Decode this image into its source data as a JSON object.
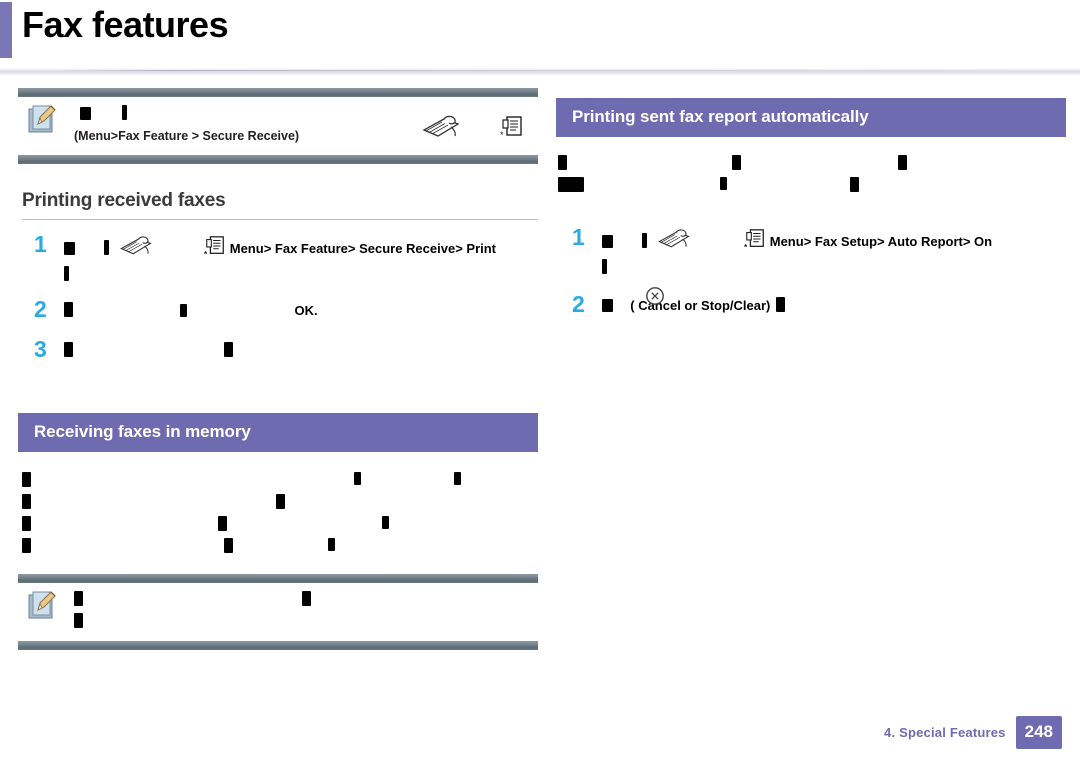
{
  "page": {
    "title": "Fax features",
    "accent_color": "#7b77b5",
    "step_number_color": "#29abe2",
    "note_bar_color": "#6c7a83"
  },
  "footer": {
    "chapter": "4.  Special Features",
    "page_number": "248"
  },
  "note_top": {
    "icon": "note-pencil-icon",
    "glyph_line": "",
    "path_text": "(Menu>Fax Feature    >  Secure Receive)",
    "inline_icons": [
      "fax-machine-icon",
      "menu-button-icon"
    ]
  },
  "sections": [
    {
      "id": "printing-received-faxes",
      "style": "plain",
      "heading": "Printing received faxes",
      "steps": [
        {
          "number": "1",
          "icons": [
            "fax-machine-icon",
            "menu-button-icon"
          ],
          "text": "Menu>  Fax Feature>  Secure Receive>  Print",
          "sub": ""
        },
        {
          "number": "2",
          "icons": [],
          "text": "OK.",
          "sub": ""
        },
        {
          "number": "3",
          "icons": [],
          "text": "",
          "sub": ""
        }
      ]
    },
    {
      "id": "receiving-faxes-in-memory",
      "style": "purple",
      "heading": "Receiving faxes in memory",
      "steps": []
    }
  ],
  "right_column": {
    "heading": "Printing sent fax report automatically",
    "steps": [
      {
        "number": "1",
        "icons": [
          "fax-machine-icon",
          "menu-button-icon"
        ],
        "text": "Menu>  Fax Setup>  Auto Report>  On",
        "sub": ""
      },
      {
        "number": "2",
        "icons": [
          "cancel-button-icon"
        ],
        "text": "(          Cancel or  Stop/Clear)",
        "sub": ""
      }
    ]
  },
  "note_bottom": {
    "icon": "note-pencil-icon",
    "glyph_line": ""
  }
}
